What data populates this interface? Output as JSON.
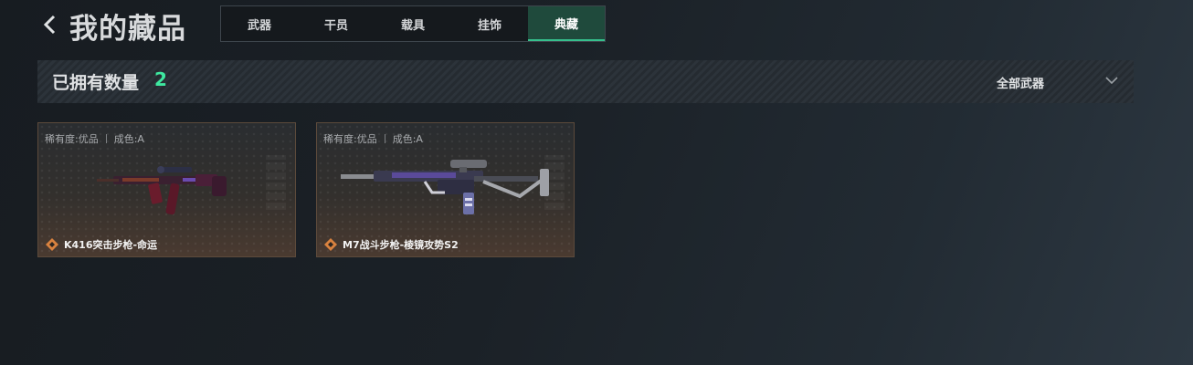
{
  "header": {
    "title": "我的藏品",
    "tabs": [
      {
        "label": "武器",
        "active": false
      },
      {
        "label": "干员",
        "active": false
      },
      {
        "label": "载具",
        "active": false
      },
      {
        "label": "挂饰",
        "active": false
      },
      {
        "label": "典藏",
        "active": true
      }
    ]
  },
  "summary": {
    "owned_label": "已拥有数量",
    "owned_count": "2",
    "filter_label": "全部武器"
  },
  "items": [
    {
      "rarity": "稀有度:优品",
      "condition": "成色:A",
      "name": "K416突击步枪-命运"
    },
    {
      "rarity": "稀有度:优品",
      "condition": "成色:A",
      "name": "M7战斗步枪-棱镜攻势S2"
    }
  ],
  "colors": {
    "accent": "#3ee8a0",
    "active_tab_bg": "#1f4a3c",
    "rarity_orange": "#d9823f"
  }
}
